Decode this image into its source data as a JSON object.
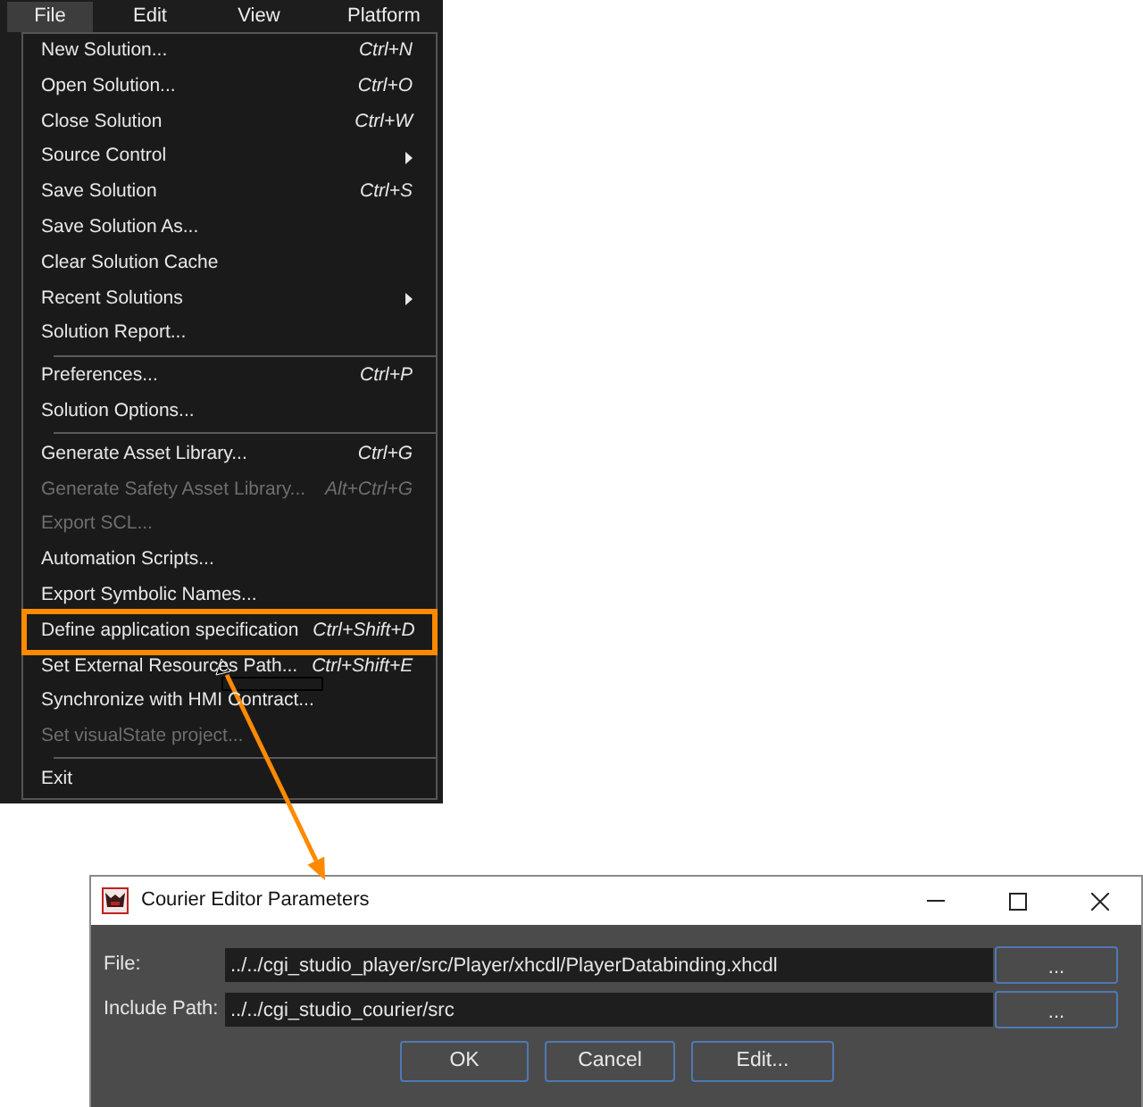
{
  "menubar": {
    "items": [
      {
        "label": "File",
        "selected": true
      },
      {
        "label": "Edit",
        "selected": false
      },
      {
        "label": "View",
        "selected": false
      },
      {
        "label": "Platform",
        "selected": false
      }
    ]
  },
  "file_menu": {
    "groups": [
      {
        "items": [
          {
            "kind": "item",
            "label": "New Solution...",
            "shortcut": "Ctrl+N",
            "disabled": false,
            "callout": false
          },
          {
            "kind": "item",
            "label": "Open Solution...",
            "shortcut": "Ctrl+O",
            "disabled": false,
            "callout": false
          },
          {
            "kind": "item",
            "label": "Close Solution",
            "shortcut": "Ctrl+W",
            "disabled": false,
            "callout": false
          },
          {
            "kind": "submenu",
            "label": "Source Control",
            "disabled": false,
            "callout": false
          },
          {
            "kind": "item",
            "label": "Save Solution",
            "shortcut": "Ctrl+S",
            "disabled": false,
            "callout": false
          },
          {
            "kind": "item",
            "label": "Save Solution As...",
            "disabled": false,
            "callout": false
          },
          {
            "kind": "item",
            "label": "Clear Solution Cache",
            "disabled": false,
            "callout": false
          },
          {
            "kind": "submenu",
            "label": "Recent Solutions",
            "disabled": false,
            "callout": false
          },
          {
            "kind": "item",
            "label": "Solution Report...",
            "disabled": false,
            "callout": false
          }
        ]
      },
      {
        "items": [
          {
            "kind": "item",
            "label": "Preferences...",
            "shortcut": "Ctrl+P",
            "disabled": false,
            "callout": false
          },
          {
            "kind": "item",
            "label": "Solution Options...",
            "disabled": false,
            "callout": false
          }
        ]
      },
      {
        "items": [
          {
            "kind": "item",
            "label": "Generate Asset Library...",
            "shortcut": "Ctrl+G",
            "disabled": false,
            "callout": false
          },
          {
            "kind": "item",
            "label": "Generate Safety Asset Library...",
            "shortcut": "Alt+Ctrl+G",
            "disabled": true,
            "callout": false
          },
          {
            "kind": "item",
            "label": "Export SCL...",
            "disabled": true,
            "callout": false
          },
          {
            "kind": "item",
            "label": "Automation Scripts...",
            "disabled": false,
            "callout": false
          },
          {
            "kind": "item",
            "label": "Export Symbolic Names...",
            "disabled": false,
            "callout": false
          },
          {
            "kind": "item",
            "label": "Define application specification",
            "shortcut": "Ctrl+Shift+D",
            "disabled": false,
            "callout": true
          },
          {
            "kind": "item",
            "label": "Set External Resources Path...",
            "shortcut": "Ctrl+Shift+E",
            "disabled": false,
            "callout": false
          },
          {
            "kind": "item",
            "label": "Synchronize with HMI Contract...",
            "disabled": false,
            "callout": false
          },
          {
            "kind": "item",
            "label": "Set visualState project...",
            "disabled": true,
            "callout": false
          }
        ]
      },
      {
        "items": [
          {
            "kind": "item",
            "label": "Exit",
            "disabled": false,
            "callout": false
          }
        ]
      }
    ]
  },
  "dialog": {
    "title": "Courier Editor Parameters",
    "fields": [
      {
        "label": "File:",
        "value": "../../cgi_studio_player/src/Player/xhcdl/PlayerDatabinding.xhcdl",
        "button": "..."
      },
      {
        "label": "Include Path:",
        "value": "../../cgi_studio_courier/src",
        "button": "..."
      }
    ],
    "buttons": [
      "OK",
      "Cancel",
      "Edit..."
    ]
  }
}
